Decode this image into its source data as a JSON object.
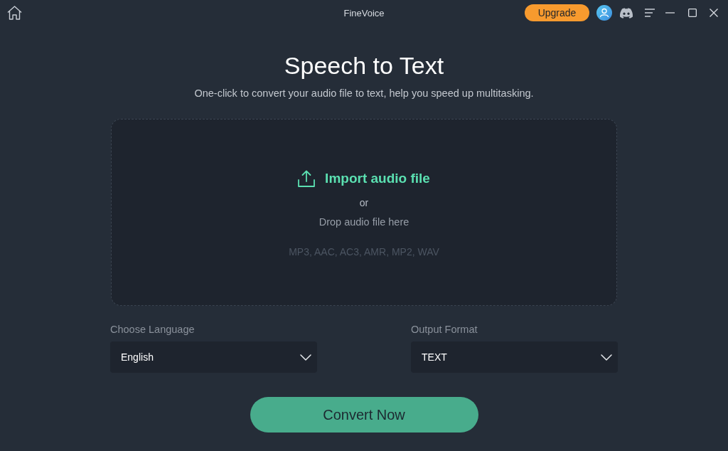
{
  "window": {
    "title": "FineVoice"
  },
  "title_bar": {
    "upgrade_button": "Upgrade"
  },
  "heading": "Speech to Text",
  "subtitle": "One-click to convert your audio file to text, help you speed up multitasking.",
  "drop_zone": {
    "import_label": "Import audio file",
    "separator": "or",
    "drop_hint": "Drop audio file here",
    "formats": "MP3, AAC, AC3, AMR, MP2, WAV"
  },
  "options": [
    {
      "label": "Choose Language",
      "value": "English"
    },
    {
      "label": "Output Format",
      "value": "TEXT"
    }
  ],
  "convert_button": "Convert Now"
}
